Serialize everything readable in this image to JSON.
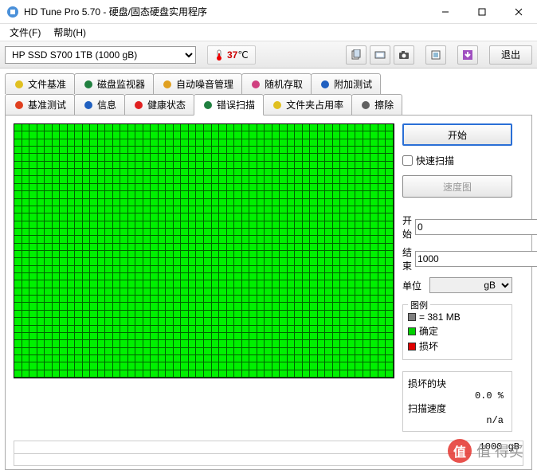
{
  "title": "HD Tune Pro 5.70 - 硬盘/固态硬盘实用程序",
  "menu": {
    "file": "文件(F)",
    "help": "帮助(H)"
  },
  "toolbar": {
    "drive": "HP SSD S700 1TB (1000 gB)",
    "temp_value": "37",
    "temp_unit": "℃",
    "exit": "退出"
  },
  "tabs_row1": [
    {
      "label": "文件基准",
      "icon_color": "#e0c020"
    },
    {
      "label": "磁盘监视器",
      "icon_color": "#208040"
    },
    {
      "label": "自动噪音管理",
      "icon_color": "#e0a020"
    },
    {
      "label": "随机存取",
      "icon_color": "#d04080"
    },
    {
      "label": "附加测试",
      "icon_color": "#2060c0"
    }
  ],
  "tabs_row2": [
    {
      "label": "基准测试",
      "icon_color": "#e04020"
    },
    {
      "label": "信息",
      "icon_color": "#2060c0"
    },
    {
      "label": "健康状态",
      "icon_color": "#e02020"
    },
    {
      "label": "错误扫描",
      "icon_color": "#208040",
      "active": true
    },
    {
      "label": "文件夹占用率",
      "icon_color": "#e0c020"
    },
    {
      "label": "擦除",
      "icon_color": "#606060"
    }
  ],
  "scan": {
    "start_btn": "开始",
    "quick_scan": "快速扫描",
    "speedmap_btn": "速度图",
    "start_label": "开始",
    "start_value": "0",
    "end_label": "结束",
    "end_value": "1000",
    "unit_label": "单位",
    "unit_value": "gB"
  },
  "legend": {
    "title": "图例",
    "block_size": "= 381 MB",
    "ok": "确定",
    "damaged": "损坏",
    "colors": {
      "block": "#808080",
      "ok": "#00d000",
      "damaged": "#e00000"
    }
  },
  "stats": {
    "damaged_label": "损坏的块",
    "damaged_value": "0.0 %",
    "speed_label": "扫描速度",
    "speed_value": "n/a"
  },
  "status": {
    "total": "1000 gB"
  },
  "watermark": "值  得买"
}
